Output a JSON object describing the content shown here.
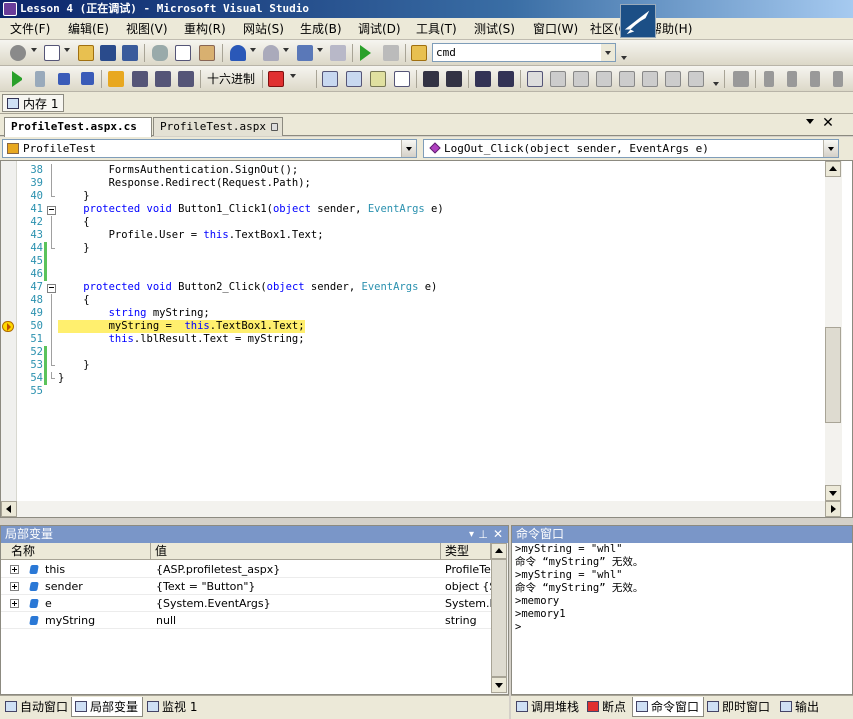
{
  "window": {
    "title": "Lesson 4 (正在调试) - Microsoft Visual Studio"
  },
  "menu": [
    "文件(F)",
    "编辑(E)",
    "视图(V)",
    "重构(R)",
    "网站(S)",
    "生成(B)",
    "调试(D)",
    "工具(T)",
    "测试(S)",
    "窗口(W)",
    "社区(C)",
    "帮助(H)"
  ],
  "toolbar": {
    "command_value": "cmd",
    "hex_label": "十六进制"
  },
  "memory_tab": {
    "label": "内存 1"
  },
  "doc_tabs": [
    {
      "label": "ProfileTest.aspx.cs",
      "active": true
    },
    {
      "label": "ProfileTest.aspx",
      "active": false
    }
  ],
  "nav": {
    "class_combo": "ProfileTest",
    "member_combo": "LogOut_Click(object sender, EventArgs e)"
  },
  "code": {
    "lines": [
      {
        "num": "38",
        "text": "        FormsAuthentication.SignOut();"
      },
      {
        "num": "39",
        "text": "        Response.Redirect(Request.Path);"
      },
      {
        "num": "40",
        "text": "    }"
      },
      {
        "num": "41",
        "text": "    protected void Button1_Click1(object sender, EventArgs e)"
      },
      {
        "num": "42",
        "text": "    {"
      },
      {
        "num": "43",
        "text": "        Profile.User = this.TextBox1.Text;"
      },
      {
        "num": "44",
        "text": "    }"
      },
      {
        "num": "45",
        "text": ""
      },
      {
        "num": "46",
        "text": ""
      },
      {
        "num": "47",
        "text": "    protected void Button2_Click(object sender, EventArgs e)"
      },
      {
        "num": "48",
        "text": "    {"
      },
      {
        "num": "49",
        "text": "        string myString;"
      },
      {
        "num": "50",
        "text": "        myString =  this.TextBox1.Text;"
      },
      {
        "num": "51",
        "text": "        this.lblResult.Text = myString;"
      },
      {
        "num": "52",
        "text": ""
      },
      {
        "num": "53",
        "text": "    }"
      },
      {
        "num": "54",
        "text": "}"
      },
      {
        "num": "55",
        "text": ""
      }
    ],
    "current_line": "50"
  },
  "locals": {
    "title": "局部变量",
    "columns": [
      "名称",
      "值",
      "类型"
    ],
    "rows": [
      {
        "name": "this",
        "value": "{ASP.profiletest_aspx}",
        "type": "ProfileTes"
      },
      {
        "name": "sender",
        "value": "{Text = \"Button\"}",
        "type": "object {Sy"
      },
      {
        "name": "e",
        "value": "{System.EventArgs}",
        "type": "System.E"
      },
      {
        "name": "myString",
        "value": "null",
        "type": "string"
      }
    ]
  },
  "command_window": {
    "title": "命令窗口",
    "lines": [
      ">myString = \"whl\"",
      "命令 “myString” 无效。",
      ">myString = \"whl\"",
      "命令 “myString” 无效。",
      ">memory",
      ">memory1",
      ">"
    ]
  },
  "left_tabs": [
    "自动窗口",
    "局部变量",
    "监视 1"
  ],
  "right_tabs": [
    "调用堆栈",
    "断点",
    "命令窗口",
    "即时窗口",
    "输出"
  ]
}
